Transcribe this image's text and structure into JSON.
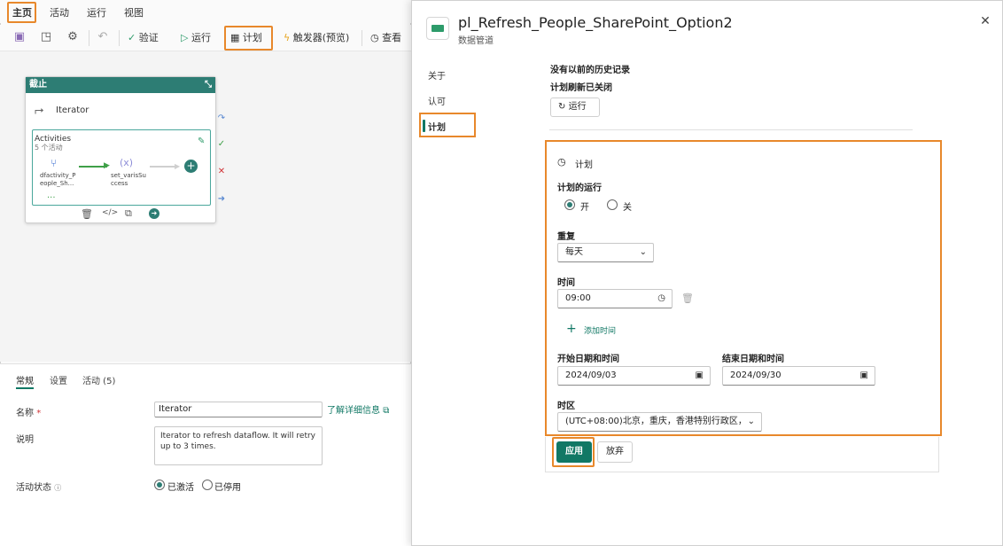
{
  "menu": {
    "home": "主页",
    "activity": "活动",
    "run": "运行",
    "view": "视图"
  },
  "toolbar": {
    "validate": "验证",
    "run": "运行",
    "schedule": "计划",
    "trigger": "触发器(预览)",
    "view_runs": "查看"
  },
  "canvas": {
    "iterator_header": "截止",
    "iterator_name": "Iterator",
    "activities_title": "Activities",
    "activities_count": "5 个活动",
    "node1_label_1": "dfactivity_P",
    "node1_label_2": "eople_Sh...",
    "node2_symbol": "(x)",
    "node2_label_1": "set_varisSu",
    "node2_label_2": "ccess",
    "more": "..."
  },
  "props": {
    "tabs": [
      "常规",
      "设置",
      "活动 (5)"
    ],
    "name_label": "名称",
    "required_mark": "*",
    "name_value": "Iterator",
    "learn_more": "了解详细信息",
    "desc_label": "说明",
    "desc_value": "Iterator to refresh dataflow. It will retry up to 3 times.",
    "status_label": "活动状态",
    "status_on": "已激活",
    "status_off": "已停用"
  },
  "panel": {
    "title": "pl_Refresh_People_SharePoint_Option2",
    "subtitle": "数据管道",
    "close": "✕",
    "nav": [
      "关于",
      "认可",
      "计划"
    ],
    "no_history": "没有以前的历史记录",
    "refresh_off": "计划刷新已关闭",
    "run_button": "运行",
    "schedule_header": "计划",
    "scheduled_run_label": "计划的运行",
    "on_label": "开",
    "off_label": "关",
    "repeat_label": "重复",
    "repeat_value": "每天",
    "time_label": "时间",
    "time_value": "09:00",
    "add_time": "添加时间",
    "start_label": "开始日期和时间",
    "start_value": "2024/09/03",
    "end_label": "结束日期和时间",
    "end_value": "2024/09/30",
    "tz_label": "时区",
    "tz_value": "(UTC+08:00)北京，重庆，香港特别行政区，",
    "apply": "应用",
    "discard": "放弃"
  },
  "colors": {
    "accent": "#117865",
    "highlight": "#e8882b",
    "header": "#2d7d74"
  }
}
